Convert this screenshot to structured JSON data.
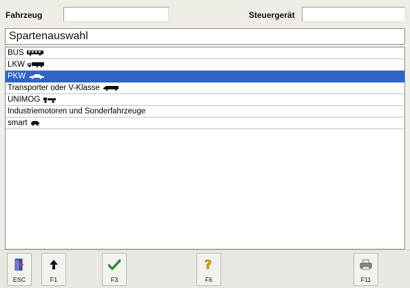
{
  "header": {
    "vehicle_label": "Fahrzeug",
    "vehicle_value": "",
    "control_unit_label": "Steuergerät",
    "control_unit_value": ""
  },
  "section": {
    "title": "Spartenauswahl"
  },
  "list": {
    "selected_index": 2,
    "items": [
      {
        "label": "BUS",
        "icon": "bus-icon"
      },
      {
        "label": "LKW",
        "icon": "truck-icon"
      },
      {
        "label": "PKW",
        "icon": "car-icon"
      },
      {
        "label": "Transporter oder V-Klasse",
        "icon": "van-icon"
      },
      {
        "label": "UNIMOG",
        "icon": "unimog-icon"
      },
      {
        "label": "Industriemotoren und Sonderfahrzeuge",
        "icon": ""
      },
      {
        "label": "smart",
        "icon": "smart-car-icon"
      }
    ]
  },
  "toolbar": {
    "buttons": [
      {
        "key": "ESC",
        "icon": "exit-door-icon"
      },
      {
        "key": "F1",
        "icon": "up-arrow-icon"
      },
      {
        "key": "F3",
        "icon": "checkmark-icon"
      },
      {
        "key": "F6",
        "icon": "help-question-icon"
      },
      {
        "key": "F11",
        "icon": "printer-icon"
      }
    ]
  },
  "colors": {
    "background": "#f0efea",
    "selection": "#2e64c8",
    "row_divider": "#b9c3cf",
    "checkmark": "#2e8b2e",
    "help": "#e0b400"
  }
}
